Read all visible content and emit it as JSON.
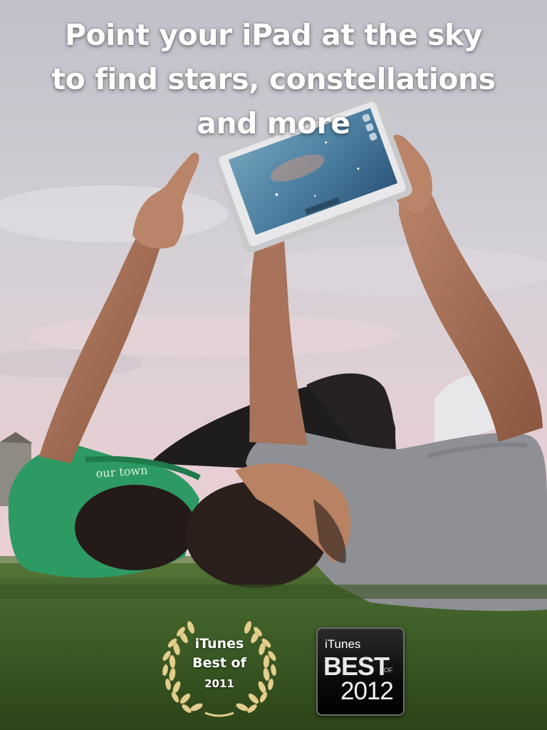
{
  "headline": {
    "line1": "Point your iPad at the sky",
    "line2": "to find stars, constellations",
    "line3": "and more"
  },
  "shirt_text": "our town",
  "badges": {
    "laurel": {
      "line1": "iTunes",
      "line2": "Best of",
      "year": "2011"
    },
    "best": {
      "brand": "iTunes",
      "word": "BEST",
      "of": "OF",
      "year": "2012"
    }
  },
  "colors": {
    "sky_top": "#c9c7cf",
    "sky_bottom": "#e6cdd3",
    "grass": "#3f5e28",
    "green_shirt": "#2e9a63",
    "grey_shirt": "#8e9095",
    "skin": "#b57a5c",
    "hair": "#2a1f1b",
    "laurel_gold": "#e2cf8e"
  }
}
